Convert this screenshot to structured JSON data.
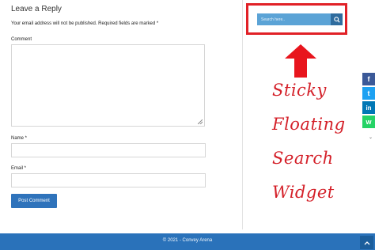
{
  "comment_form": {
    "title": "Leave a Reply",
    "notes": "Your email address will not be published. Required fields are marked *",
    "comment_label": "Comment",
    "name_label": "Name *",
    "email_label": "Email *",
    "submit_label": "Post Comment"
  },
  "search_widget": {
    "placeholder": "Search here..",
    "button_icon": "search-icon"
  },
  "annotation": {
    "lines": [
      "Sticky",
      "Floating",
      "Search",
      "Widget"
    ],
    "color": "#d42029"
  },
  "share_bar": {
    "buttons": [
      {
        "name": "facebook",
        "glyph": "f",
        "color": "#3b5998"
      },
      {
        "name": "twitter",
        "glyph": "t",
        "color": "#1da1f2"
      },
      {
        "name": "linkedin",
        "glyph": "in",
        "color": "#0077b5"
      },
      {
        "name": "whatsapp",
        "glyph": "w",
        "color": "#25d366"
      }
    ]
  },
  "footer": {
    "copyright": "© 2021 - Convey Arena",
    "accent": "#2a72ba"
  }
}
